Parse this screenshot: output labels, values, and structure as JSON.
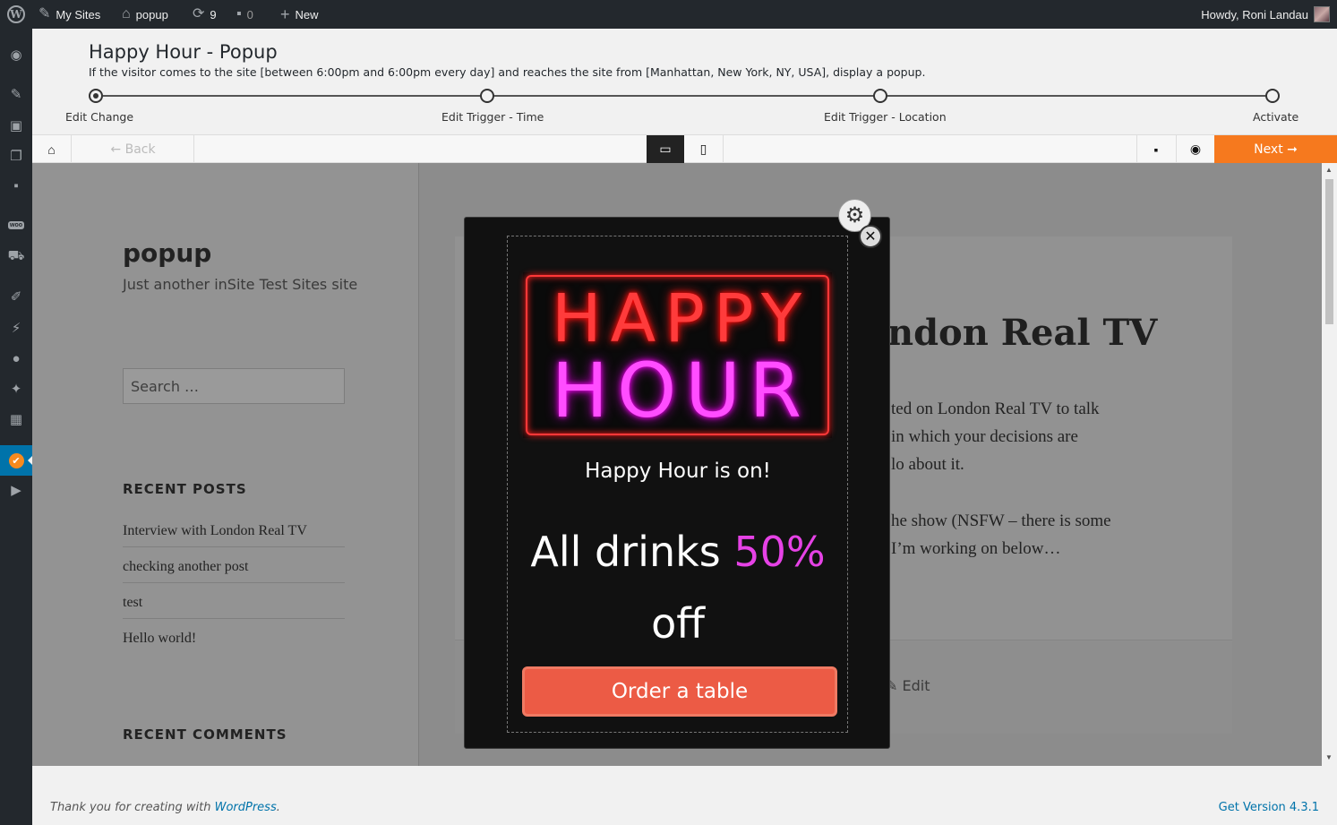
{
  "adminbar": {
    "my_sites": "My Sites",
    "site_name": "popup",
    "updates_count": "9",
    "comments_count": "0",
    "new_label": "New",
    "howdy": "Howdy, Roni Landau"
  },
  "wizard": {
    "title": "Happy Hour - Popup",
    "description": "If the visitor comes to the site [between 6:00pm and 6:00pm every day] and reaches the site from [Manhattan, New York, NY, USA], display a popup.",
    "steps": [
      {
        "label": "Edit Change",
        "current": true
      },
      {
        "label": "Edit Trigger - Time",
        "current": false
      },
      {
        "label": "Edit Trigger - Location",
        "current": false
      },
      {
        "label": "Activate",
        "current": false
      }
    ]
  },
  "toolbar": {
    "back_label": "← Back",
    "next_label": "Next ➞",
    "view_mode": "desktop"
  },
  "site": {
    "title": "popup",
    "tagline": "Just another inSite Test Sites site",
    "search_placeholder": "Search …",
    "recent_posts_heading": "RECENT POSTS",
    "recent_posts": [
      "Interview with London Real TV",
      "checking another post",
      "test",
      "Hello world!"
    ],
    "recent_comments_heading": "RECENT COMMENTS",
    "article_title": "ndon Real TV",
    "article_lines": [
      "ted on London Real TV to talk",
      "in which your decisions are",
      "lo about it.",
      "he show (NSFW – there is some",
      "I’m working on below…"
    ],
    "edit_label": "Edit"
  },
  "popup": {
    "neon_line1": "HAPPY",
    "neon_line2": "HOUR",
    "subtitle": "Happy Hour is on!",
    "offer_prefix": "All drinks",
    "offer_pct": "50%",
    "offer_suffix": "off",
    "button_label": "Order a table",
    "colors": {
      "accent": "#e642e6",
      "button": "#ec5b45",
      "neon_red": "#ff3b3b"
    }
  },
  "footer": {
    "thanks_prefix": "Thank you for creating with",
    "thanks_link": "WordPress",
    "version": "Get Version 4.3.1"
  }
}
